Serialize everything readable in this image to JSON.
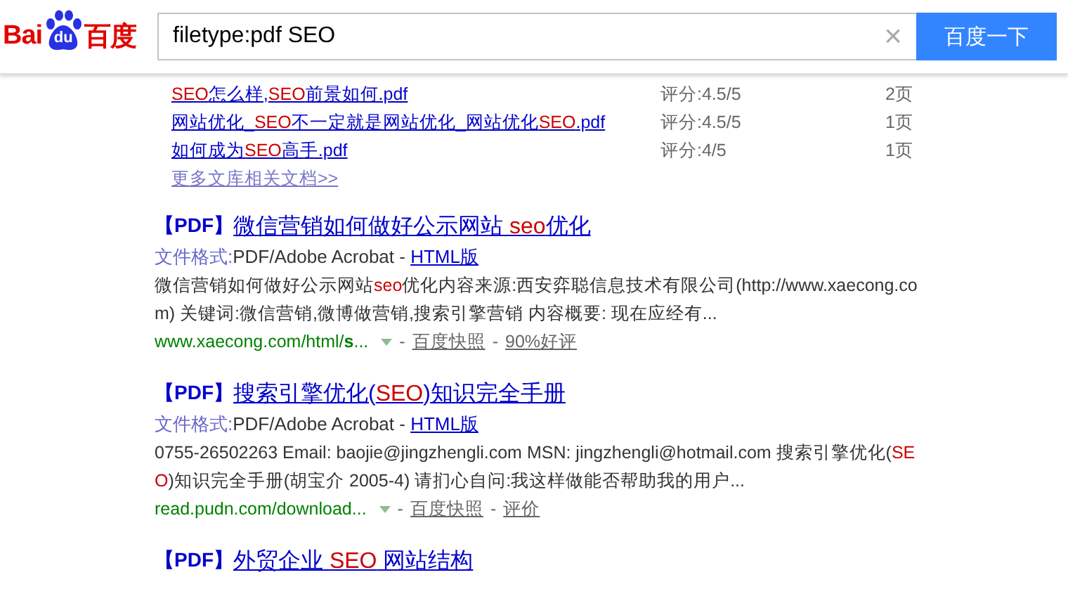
{
  "header": {
    "logo": {
      "left": "Bai",
      "paw": "du",
      "right": "百度"
    },
    "search": {
      "value": "filetype:pdf SEO",
      "clear": "×",
      "button": "百度一下"
    }
  },
  "docs": {
    "items": [
      {
        "title": [
          {
            "t": "SEO",
            "hl": true
          },
          {
            "t": "怎么样,",
            "hl": false
          },
          {
            "t": "SEO",
            "hl": true
          },
          {
            "t": "前景如何.pdf",
            "hl": false
          }
        ],
        "rating": "评分:4.5/5",
        "pages": "2页"
      },
      {
        "title": [
          {
            "t": "网站优化_",
            "hl": false
          },
          {
            "t": "SEO",
            "hl": true
          },
          {
            "t": "不一定就是网站优化_网站优化",
            "hl": false
          },
          {
            "t": "SEO",
            "hl": true
          },
          {
            "t": ".pdf",
            "hl": false
          }
        ],
        "rating": "评分:4.5/5",
        "pages": "1页"
      },
      {
        "title": [
          {
            "t": "如何成为",
            "hl": false
          },
          {
            "t": "SEO",
            "hl": true
          },
          {
            "t": "高手.pdf",
            "hl": false
          }
        ],
        "rating": "评分:4/5",
        "pages": "1页"
      }
    ],
    "more": "更多文库相关文档>>"
  },
  "results": [
    {
      "tag": "【PDF】",
      "title": [
        {
          "t": "微信营销如何做好公示网站 ",
          "hl": false
        },
        {
          "t": "seo",
          "hl": true
        },
        {
          "t": "优化",
          "hl": false
        }
      ],
      "format_label": "文件格式:",
      "format": "PDF/Adobe Acrobat - ",
      "html_link": "HTML版",
      "description": [
        {
          "t": "微信营销如何做好公示网站",
          "hl": false
        },
        {
          "t": "seo",
          "hl": true
        },
        {
          "t": "优化内容来源:西安弈聪信息技术有限公司(http://www.xaecong.com) 关键词:微信营销,微博做营销,搜索引擎营销 内容概要: 现在应经有...",
          "hl": false
        }
      ],
      "url": "www.xaecong.com/html/**s**...",
      "separators": [
        "-",
        "-"
      ],
      "snapshot": "百度快照",
      "extra": "90%好评"
    },
    {
      "tag": "【PDF】",
      "title": [
        {
          "t": "搜索引擎优化(",
          "hl": false
        },
        {
          "t": "SEO",
          "hl": true
        },
        {
          "t": ")知识完全手册",
          "hl": false
        }
      ],
      "format_label": "文件格式:",
      "format": "PDF/Adobe Acrobat - ",
      "html_link": "HTML版",
      "description": [
        {
          "t": "0755-26502263 Email: baojie@jingzhengli.com MSN: jingzhengli@hotmail.com 搜索引擎优化(",
          "hl": false
        },
        {
          "t": "SEO",
          "hl": true
        },
        {
          "t": ")知识完全手册(胡宝介 2005-4) 请扪心自问:我这样做能否帮助我的用户...",
          "hl": false
        }
      ],
      "url": "read.pudn.com/download...",
      "separators": [
        "-",
        "-"
      ],
      "snapshot": "百度快照",
      "extra": "评价"
    },
    {
      "tag": "【PDF】",
      "title": [
        {
          "t": "外贸企业 ",
          "hl": false
        },
        {
          "t": "SEO",
          "hl": true
        },
        {
          "t": " 网站结构",
          "hl": false
        }
      ]
    }
  ]
}
